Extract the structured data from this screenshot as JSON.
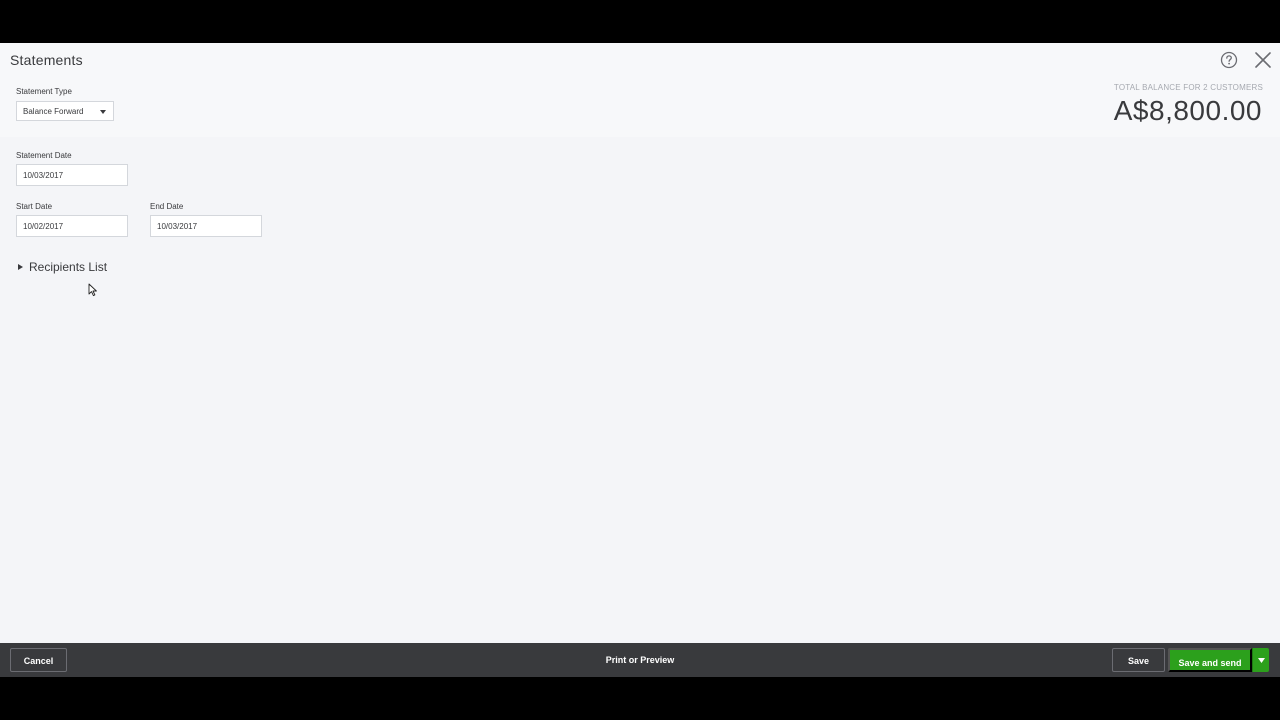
{
  "header": {
    "title": "Statements"
  },
  "form": {
    "statement_type": {
      "label": "Statement Type",
      "value": "Balance Forward"
    },
    "statement_date": {
      "label": "Statement Date",
      "value": "10/03/2017"
    },
    "start_date": {
      "label": "Start Date",
      "value": "10/02/2017"
    },
    "end_date": {
      "label": "End Date",
      "value": "10/03/2017"
    }
  },
  "balance": {
    "label": "TOTAL BALANCE FOR 2 CUSTOMERS",
    "amount": "A$8,800.00"
  },
  "recipients": {
    "label": "Recipients List"
  },
  "footer": {
    "cancel_label": "Cancel",
    "print_label": "Print or Preview",
    "save_label": "Save",
    "save_send_label": "Save and send"
  },
  "colors": {
    "accent_green": "#2ca01c",
    "footer_bg": "#393a3d"
  },
  "icons": [
    "help-icon",
    "close-icon",
    "chevron-down-icon",
    "caret-right-icon",
    "mouse-cursor-icon"
  ]
}
